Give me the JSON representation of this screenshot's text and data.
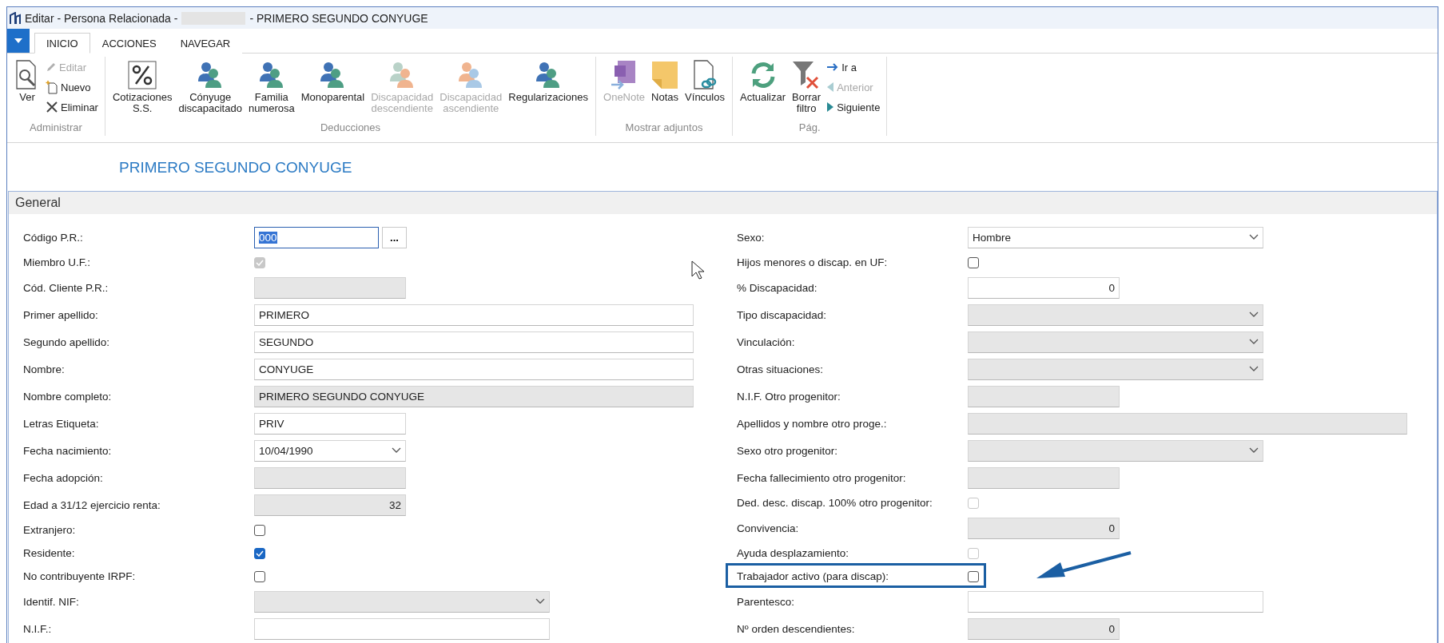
{
  "window": {
    "title_prefix": "Editar - Persona Relacionada -",
    "title_suffix": "- PRIMERO SEGUNDO CONYUGE"
  },
  "tabs": [
    {
      "label": "INICIO",
      "selected": true
    },
    {
      "label": "ACCIONES",
      "selected": false
    },
    {
      "label": "NAVEGAR",
      "selected": false
    }
  ],
  "ribbon": {
    "groups": [
      {
        "name": "Administrar",
        "items": [
          {
            "kind": "large",
            "label": "Ver",
            "disabled": false
          },
          {
            "kind": "stack",
            "items": [
              {
                "label": "Editar",
                "disabled": true
              },
              {
                "label": "Nuevo",
                "disabled": false
              },
              {
                "label": "Eliminar",
                "disabled": false
              }
            ]
          }
        ]
      },
      {
        "name": "Deducciones",
        "items": [
          {
            "kind": "large",
            "label": "Cotizaciones\nS.S.",
            "disabled": false
          },
          {
            "kind": "large",
            "label": "Cónyuge\ndiscapacitado",
            "disabled": false
          },
          {
            "kind": "large",
            "label": "Familia\nnumerosa",
            "disabled": false
          },
          {
            "kind": "large",
            "label": "Monoparental",
            "disabled": false
          },
          {
            "kind": "large",
            "label": "Discapacidad\ndescendiente",
            "disabled": true
          },
          {
            "kind": "large",
            "label": "Discapacidad\nascendiente",
            "disabled": true
          },
          {
            "kind": "large",
            "label": "Regularizaciones",
            "disabled": false
          }
        ]
      },
      {
        "name": "Mostrar adjuntos",
        "items": [
          {
            "kind": "large",
            "label": "OneNote",
            "disabled": true
          },
          {
            "kind": "large",
            "label": "Notas",
            "disabled": false
          },
          {
            "kind": "large",
            "label": "Vínculos",
            "disabled": false
          }
        ]
      },
      {
        "name": "Pág.",
        "items": [
          {
            "kind": "large",
            "label": "Actualizar",
            "disabled": false
          },
          {
            "kind": "large",
            "label": "Borrar\nfiltro",
            "disabled": false
          },
          {
            "kind": "stack",
            "items": [
              {
                "label": "Ir a",
                "disabled": false
              },
              {
                "label": "Anterior",
                "disabled": true
              },
              {
                "label": "Siguiente",
                "disabled": false
              }
            ]
          }
        ]
      }
    ]
  },
  "heading": "PRIMERO SEGUNDO CONYUGE",
  "section": {
    "title": "General",
    "left": [
      {
        "label": "Código P.R.:",
        "kind": "lookup",
        "value": "000",
        "button_label": "...",
        "focused": true,
        "disabled": false
      },
      {
        "label": "Miembro U.F.:",
        "kind": "check",
        "checked": true,
        "disabled": true
      },
      {
        "label": "Cód. Cliente P.R.:",
        "kind": "text_short",
        "disabled": true
      },
      {
        "label": "Primer apellido:",
        "kind": "text_long",
        "value": "PRIMERO",
        "disabled": false
      },
      {
        "label": "Segundo apellido:",
        "kind": "text_long",
        "value": "SEGUNDO",
        "disabled": false
      },
      {
        "label": "Nombre:",
        "kind": "text_long",
        "value": "CONYUGE",
        "disabled": false
      },
      {
        "label": "Nombre completo:",
        "kind": "text_long",
        "value": "PRIMERO SEGUNDO CONYUGE",
        "disabled": true
      },
      {
        "label": "Letras Etiqueta:",
        "kind": "text_short",
        "value": "PRIV",
        "disabled": false
      },
      {
        "label": "Fecha nacimiento:",
        "kind": "select_short",
        "value": "10/04/1990",
        "disabled": false
      },
      {
        "label": "Fecha adopción:",
        "kind": "text_short",
        "disabled": true
      },
      {
        "label": "Edad a 31/12 ejercicio renta:",
        "kind": "number",
        "value": "32",
        "disabled": true
      },
      {
        "label": "Extranjero:",
        "kind": "check",
        "checked": false,
        "disabled": false
      },
      {
        "label": "Residente:",
        "kind": "check",
        "checked": true,
        "disabled": false
      },
      {
        "label": "No contribuyente IRPF:",
        "kind": "check",
        "checked": false,
        "disabled": false
      },
      {
        "label": "Identif. NIF:",
        "kind": "select_medium",
        "disabled": true
      },
      {
        "label": "N.I.F.:",
        "kind": "text_medium",
        "disabled": false
      }
    ],
    "right": [
      {
        "label": "Sexo:",
        "kind": "select_medium",
        "value": "Hombre",
        "disabled": false
      },
      {
        "label": "Hijos menores o discap. en UF:",
        "kind": "check",
        "checked": false,
        "disabled": false
      },
      {
        "label": "% Discapacidad:",
        "kind": "number",
        "value": "0",
        "disabled": false
      },
      {
        "label": "Tipo discapacidad:",
        "kind": "select_medium",
        "disabled": true
      },
      {
        "label": "Vinculación:",
        "kind": "select_medium",
        "disabled": true
      },
      {
        "label": "Otras situaciones:",
        "kind": "select_medium",
        "disabled": true
      },
      {
        "label": "N.I.F. Otro progenitor:",
        "kind": "text_short",
        "disabled": true
      },
      {
        "label": "Apellidos y nombre otro proge.:",
        "kind": "text_long",
        "disabled": true
      },
      {
        "label": "Sexo otro progenitor:",
        "kind": "select_medium",
        "disabled": true
      },
      {
        "label": "Fecha fallecimiento otro progenitor:",
        "kind": "text_short",
        "disabled": true
      },
      {
        "label": "Ded. desc. discap. 100% otro progenitor:",
        "kind": "check",
        "checked": false,
        "disabled": true
      },
      {
        "label": "Convivencia:",
        "kind": "number",
        "value": "0",
        "disabled": true
      },
      {
        "label": "Ayuda desplazamiento:",
        "kind": "check",
        "checked": false,
        "disabled": true
      },
      {
        "label": "Trabajador activo (para discap):",
        "kind": "check",
        "checked": false,
        "disabled": false,
        "highlighted": true
      },
      {
        "label": "Parentesco:",
        "kind": "text_medium",
        "disabled": false
      },
      {
        "label": "Nº orden descendientes:",
        "kind": "number",
        "value": "0",
        "disabled": true
      }
    ]
  }
}
